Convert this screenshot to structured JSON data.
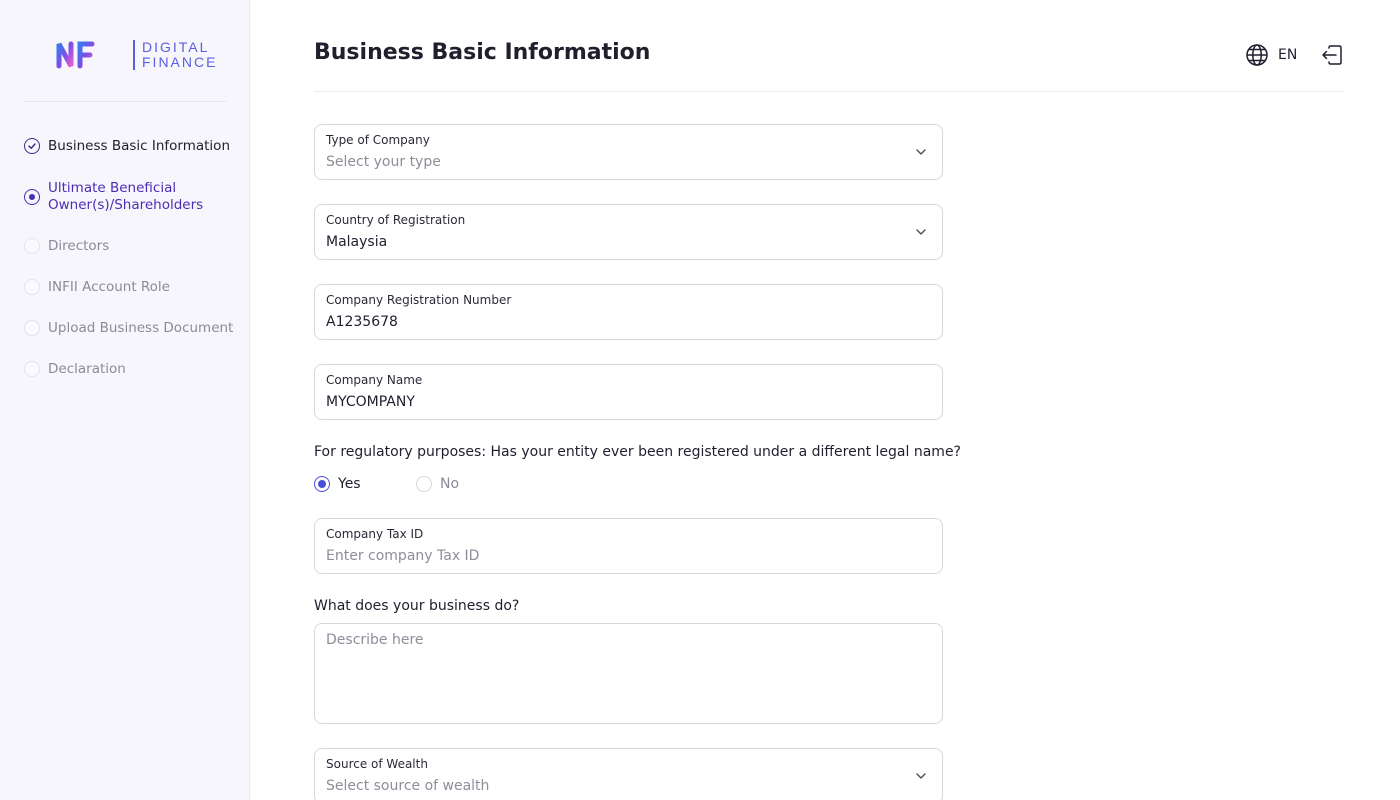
{
  "brand": {
    "mark": "INFII",
    "line1": "DIGITAL",
    "line2": "FINANCE",
    "accent": "#5b5fe0"
  },
  "steps": [
    {
      "label": "Business Basic Information",
      "state": "done"
    },
    {
      "label": "Ultimate Beneficial Owner(s)/Shareholders",
      "state": "active"
    },
    {
      "label": "Directors",
      "state": "todo"
    },
    {
      "label": "INFII Account Role",
      "state": "todo"
    },
    {
      "label": "Upload Business Document",
      "state": "todo"
    },
    {
      "label": "Declaration",
      "state": "todo"
    }
  ],
  "header": {
    "title": "Business Basic Information",
    "language": "EN",
    "globe_icon": "globe-icon",
    "logout_icon": "logout-icon"
  },
  "form": {
    "company_type": {
      "label": "Type of Company",
      "placeholder": "Select your type"
    },
    "country": {
      "label": "Country of Registration",
      "value": "Malaysia"
    },
    "reg_number": {
      "label": "Company Registration Number",
      "value": "A1235678"
    },
    "company_name": {
      "label": "Company Name",
      "value": "MYCOMPANY"
    },
    "legal_name_question": "For regulatory purposes: Has your entity ever been registered under a different legal name?",
    "legal_name_options": {
      "yes": "Yes",
      "no": "No",
      "selected": "Yes"
    },
    "tax_id": {
      "label": "Company Tax ID",
      "placeholder": "Enter company Tax ID"
    },
    "business_question": "What does your business do?",
    "business_description": {
      "placeholder": "Describe here"
    },
    "source_of_wealth": {
      "label": "Source of Wealth",
      "placeholder": "Select source of wealth"
    }
  }
}
